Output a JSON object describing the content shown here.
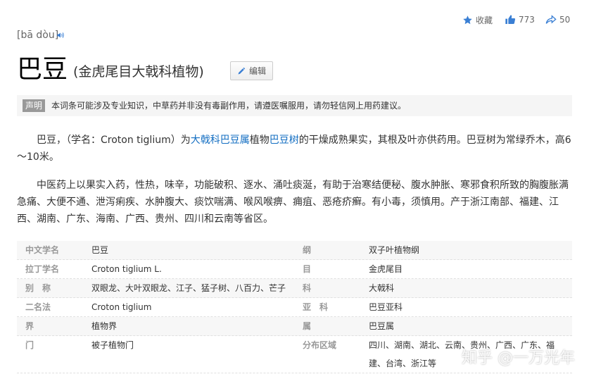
{
  "toolbar": {
    "favorite_label": "收藏",
    "like_count": "773",
    "share_count": "50"
  },
  "header": {
    "pinyin": "[bā dòu]",
    "title": "巴豆",
    "subtitle": "(金虎尾目大戟科植物)",
    "edit_label": "编辑"
  },
  "notice": {
    "tag": "声明",
    "text": "本词条可能涉及专业知识，中草药并非没有毒副作用，请遵医嘱服用，请勿轻信网上用药建议。"
  },
  "paragraph1": {
    "t1": "巴豆，（学名：Croton tiglium）为",
    "link1": "大戟科",
    "link2": "巴豆属",
    "t2": "植物",
    "link3": "巴豆树",
    "t3": "的干燥成熟果实，其根及叶亦供药用。巴豆树为常绿乔木，高6～10米。"
  },
  "paragraph2": "中医药上以果实入药，性热，味辛，功能破积、逐水、涌吐痰涎，有助于治寒结便秘、腹水肿胀、寒邪食积所致的胸腹胀满急痛、大便不通、泄泻痢疾、水肿腹大、痰饮喘满、喉风喉痹、痈疽、恶疮疥癣。有小毒，须慎用。产于浙江南部、福建、江西、湖南、广东、海南、广西、贵州、四川和云南等省区。",
  "basic_info": {
    "rows": [
      {
        "lk": "中文学名",
        "lv": "巴豆",
        "rk": "纲",
        "rv": "双子叶植物纲"
      },
      {
        "lk": "拉丁学名",
        "lv": "Croton tiglium L.",
        "rk": "目",
        "rv": "金虎尾目"
      },
      {
        "lk": "别　称",
        "lv": "双眼龙、大叶双眼龙、江子、猛子树、八百力、芒子",
        "rk": "科",
        "rv": "大戟科"
      },
      {
        "lk": "二名法",
        "lv": "Croton tiglium",
        "rk": "亚　科",
        "rv": "巴豆亚科"
      },
      {
        "lk": "界",
        "lv": "植物界",
        "rk": "属",
        "rv": "巴豆属"
      },
      {
        "lk": "门",
        "lv": "被子植物门",
        "rk": "分布区域",
        "rv": "四川、湖南、湖北、云南、贵州、广西、广东、福建、台湾、浙江等"
      }
    ]
  },
  "watermark": "知乎 @一万光年"
}
